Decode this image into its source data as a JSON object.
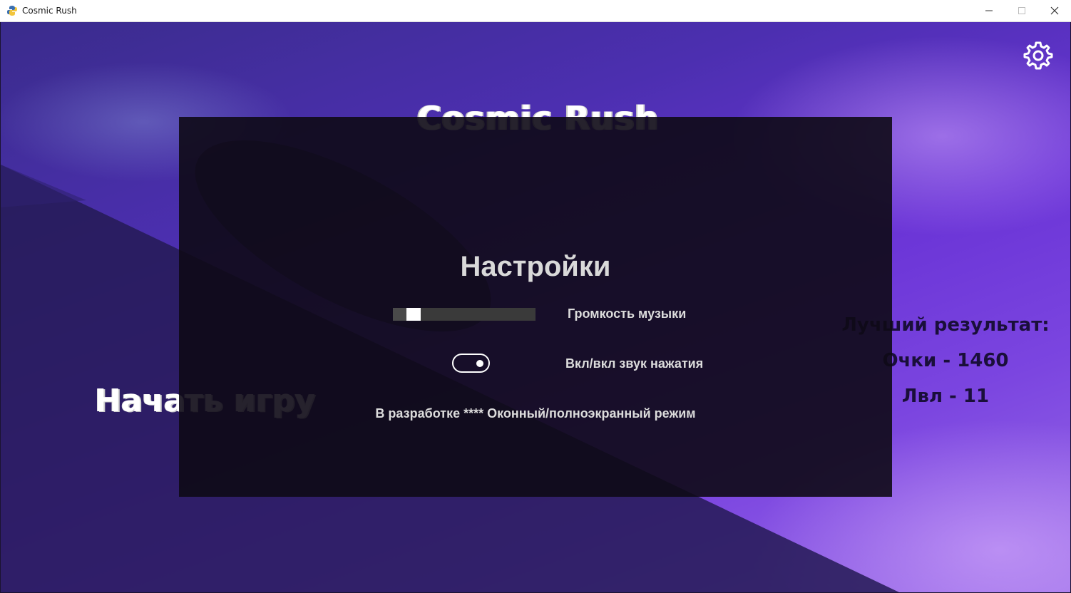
{
  "window": {
    "title": "Cosmic Rush",
    "controls": {
      "minimize": "—",
      "maximize": "☐",
      "close": "✕"
    }
  },
  "background": {
    "game_title": "Cosmic Rush",
    "start_button": "Начать игру",
    "best_result": {
      "heading": "Лучший результат:",
      "score": "Очки - 1460",
      "level": "Лвл - 11"
    }
  },
  "settings": {
    "title": "Настройки",
    "music_volume": {
      "label": "Громкость музыки",
      "value": 0.05
    },
    "click_sound": {
      "label": "Вкл/вкл звук нажатия",
      "enabled": true
    },
    "window_mode": {
      "label": "В разработке **** Оконный/полноэкранный режим"
    }
  },
  "colors": {
    "modal_bg": "#0e0a16",
    "text": "#dcdcdc",
    "slider_track": "#3a3a3a",
    "slider_handle": "#ffffff",
    "sky_accent": "#6a34d6"
  },
  "icons": {
    "app": "python-icon",
    "settings": "gear-icon"
  }
}
